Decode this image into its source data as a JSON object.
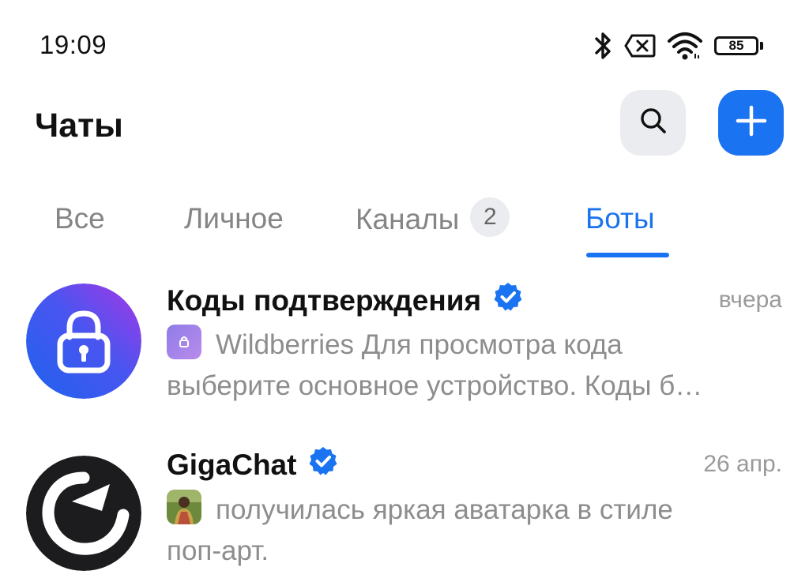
{
  "status_bar": {
    "time": "19:09",
    "battery_level": "85",
    "icons": [
      "bluetooth-icon",
      "no-sim-icon",
      "wifi-icon",
      "battery-icon"
    ]
  },
  "header": {
    "title": "Чаты",
    "search_icon": "search-icon",
    "add_icon": "plus-icon"
  },
  "tabs": [
    {
      "label": "Все",
      "active": false
    },
    {
      "label": "Личное",
      "active": false
    },
    {
      "label": "Каналы",
      "active": false,
      "badge": "2"
    },
    {
      "label": "Боты",
      "active": true
    }
  ],
  "chats": [
    {
      "name": "Коды подтверждения",
      "verified": true,
      "time": "вчера",
      "preview_line1": "Wildberries Для просмотра кода",
      "preview_line2": "выберите основное устройство. Коды б…",
      "avatar_icon": "lock-icon"
    },
    {
      "name": "GigaChat",
      "verified": true,
      "time": "26 апр.",
      "preview_line1": "получилась яркая аватарка в стиле",
      "preview_line2": "поп-арт.",
      "avatar_icon": "gigachat-logo-icon"
    }
  ],
  "colors": {
    "accent": "#1a73f0",
    "muted_text": "#8d8d8d",
    "button_bg": "#ebecef"
  }
}
